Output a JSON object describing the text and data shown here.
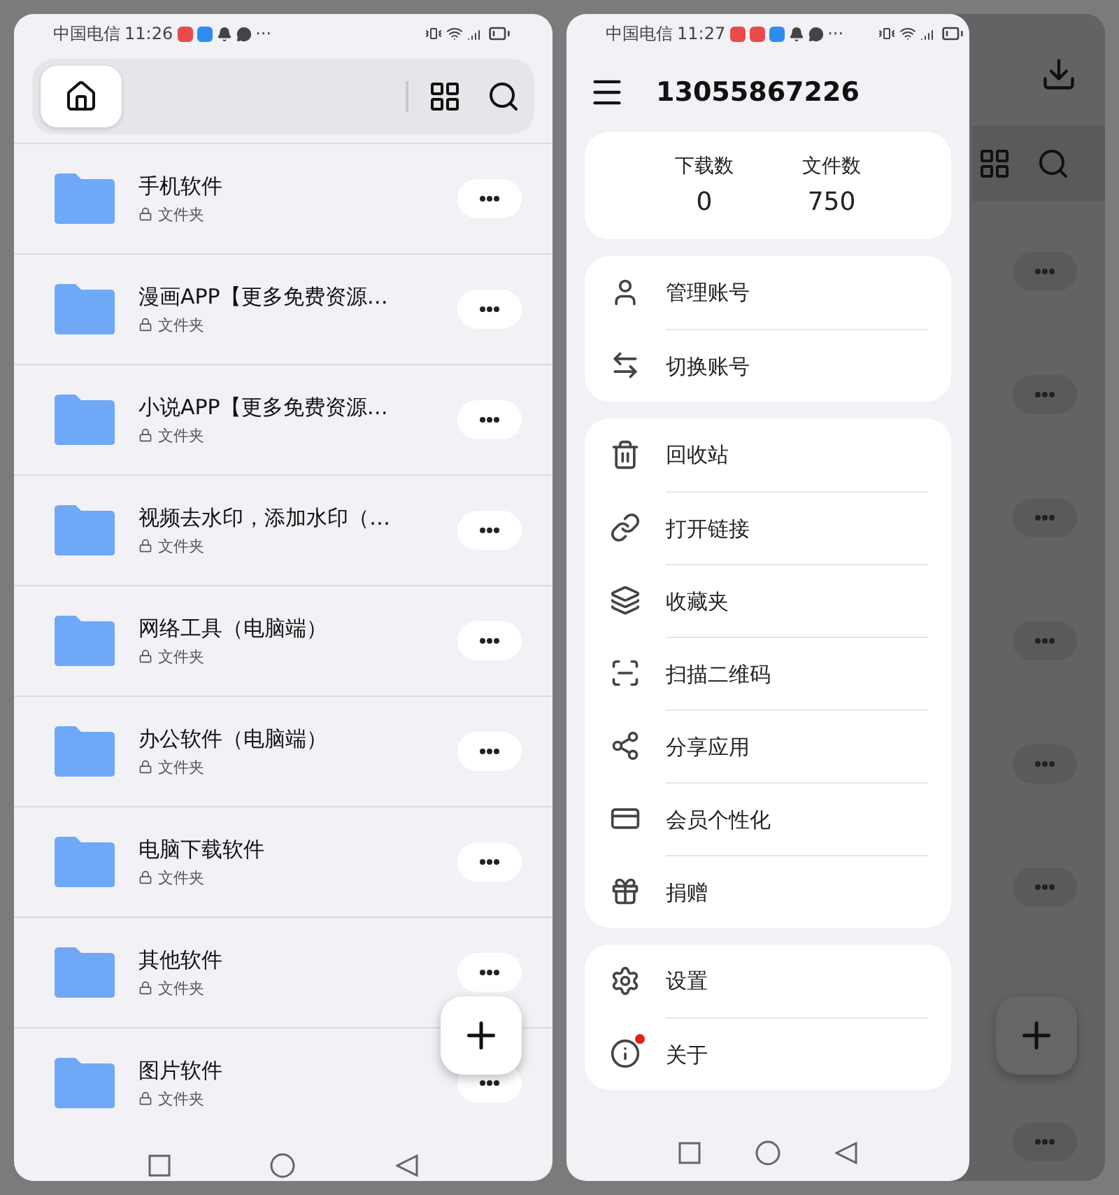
{
  "left_screen": {
    "status_bar": {
      "carrier": "中国电信",
      "time": "11:26",
      "overflow": "···"
    },
    "folders": [
      {
        "name": "手机软件",
        "type": "文件夹"
      },
      {
        "name": "漫画APP【更多免费资源…",
        "type": "文件夹"
      },
      {
        "name": "小说APP【更多免费资源…",
        "type": "文件夹"
      },
      {
        "name": "视频去水印，添加水印（…",
        "type": "文件夹"
      },
      {
        "name": "网络工具（电脑端）",
        "type": "文件夹"
      },
      {
        "name": "办公软件（电脑端）",
        "type": "文件夹"
      },
      {
        "name": "电脑下载软件",
        "type": "文件夹"
      },
      {
        "name": "其他软件",
        "type": "文件夹"
      },
      {
        "name": "图片软件",
        "type": "文件夹"
      }
    ]
  },
  "right_screen": {
    "status_bar": {
      "carrier": "中国电信",
      "time": "11:27",
      "overflow": "···"
    },
    "account": "13055867226",
    "stats": [
      {
        "label": "下载数",
        "value": "0"
      },
      {
        "label": "文件数",
        "value": "750"
      }
    ],
    "menu_groups": [
      [
        {
          "kind": "user",
          "label": "管理账号",
          "badge": false
        },
        {
          "kind": "switch",
          "label": "切换账号",
          "badge": false
        }
      ],
      [
        {
          "kind": "trash",
          "label": "回收站",
          "badge": false
        },
        {
          "kind": "link",
          "label": "打开链接",
          "badge": false
        },
        {
          "kind": "favorites",
          "label": "收藏夹",
          "badge": false
        },
        {
          "kind": "scan",
          "label": "扫描二维码",
          "badge": false
        },
        {
          "kind": "share",
          "label": "分享应用",
          "badge": false
        },
        {
          "kind": "card",
          "label": "会员个性化",
          "badge": false
        },
        {
          "kind": "gift",
          "label": "捐赠",
          "badge": false
        }
      ],
      [
        {
          "kind": "settings",
          "label": "设置",
          "badge": false
        },
        {
          "kind": "info",
          "label": "关于",
          "badge": true
        }
      ]
    ]
  }
}
